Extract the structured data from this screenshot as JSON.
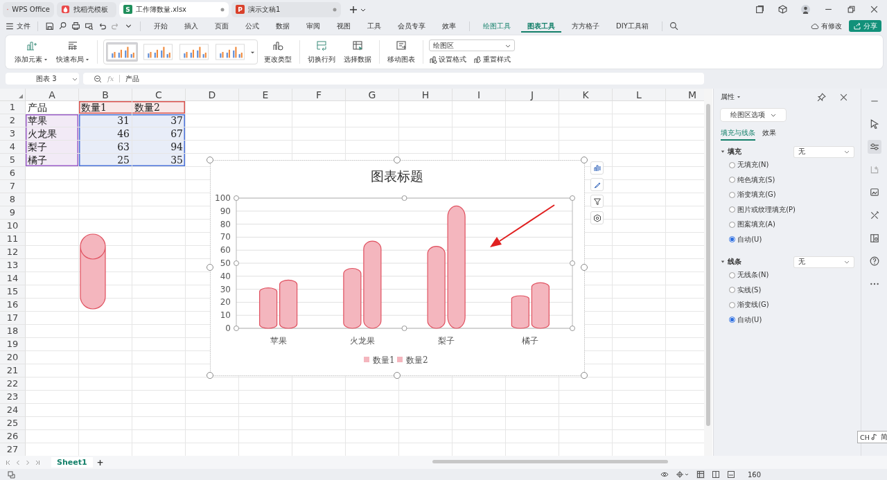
{
  "tabs": [
    {
      "label": "WPS Office",
      "selected": false,
      "kind": "home"
    },
    {
      "label": "找稻壳模板",
      "selected": false,
      "kind": "template"
    },
    {
      "label": "工作簿数量.xlsx",
      "selected": true,
      "kind": "sheet",
      "badge": "S"
    },
    {
      "label": "演示文稿1",
      "selected": false,
      "kind": "slides",
      "badge": "P"
    }
  ],
  "menu": {
    "file": "文件",
    "items": [
      {
        "label": "开始",
        "selected": false,
        "context": false
      },
      {
        "label": "插入",
        "selected": false,
        "context": false
      },
      {
        "label": "页面",
        "selected": false,
        "context": false
      },
      {
        "label": "公式",
        "selected": false,
        "context": false
      },
      {
        "label": "数据",
        "selected": false,
        "context": false
      },
      {
        "label": "审阅",
        "selected": false,
        "context": false
      },
      {
        "label": "视图",
        "selected": false,
        "context": false
      },
      {
        "label": "工具",
        "selected": false,
        "context": false
      },
      {
        "label": "会员专享",
        "selected": false,
        "context": false
      },
      {
        "label": "效率",
        "selected": false,
        "context": false
      },
      {
        "label": "绘图工具",
        "selected": false,
        "context": true
      },
      {
        "label": "图表工具",
        "selected": true,
        "context": true
      },
      {
        "label": "方方格子",
        "selected": false,
        "context": false
      },
      {
        "label": "DIY工具箱",
        "selected": false,
        "context": false
      }
    ],
    "sync": "有修改",
    "share": "分享"
  },
  "ribbon": {
    "add_element": "添加元素",
    "quick_layout": "快速布局",
    "styles": [
      {
        "selected": true
      },
      {
        "selected": false
      },
      {
        "selected": false
      },
      {
        "selected": false
      }
    ],
    "change_type": "更改类型",
    "switch_rows": "切换行列",
    "select_data": "选择数据",
    "move_chart": "移动图表",
    "element_select": "绘图区",
    "format": "设置格式",
    "reset_style": "重置样式"
  },
  "formula_bar": {
    "name_box": "图表 3",
    "fx": "fx",
    "value": "产品"
  },
  "sheet": {
    "columns": [
      "A",
      "B",
      "C",
      "D",
      "E",
      "F",
      "G",
      "H",
      "I",
      "J",
      "K",
      "L",
      "M"
    ],
    "rows": [
      {
        "label": "1",
        "cells": [
          {
            "text": "产品",
            "kind": "plain"
          },
          {
            "text": "数量1",
            "kind": "series"
          },
          {
            "text": "数量2",
            "kind": "series"
          }
        ]
      },
      {
        "label": "2",
        "cells": [
          {
            "text": "苹果",
            "kind": "category"
          },
          {
            "text": "31",
            "kind": "value"
          },
          {
            "text": "37",
            "kind": "value"
          }
        ]
      },
      {
        "label": "3",
        "cells": [
          {
            "text": "火龙果",
            "kind": "category"
          },
          {
            "text": "46",
            "kind": "value"
          },
          {
            "text": "67",
            "kind": "value"
          }
        ]
      },
      {
        "label": "4",
        "cells": [
          {
            "text": "梨子",
            "kind": "category"
          },
          {
            "text": "63",
            "kind": "value"
          },
          {
            "text": "94",
            "kind": "value"
          }
        ]
      },
      {
        "label": "5",
        "cells": [
          {
            "text": "橘子",
            "kind": "category"
          },
          {
            "text": "25",
            "kind": "value"
          },
          {
            "text": "35",
            "kind": "value"
          }
        ]
      },
      {
        "label": "6"
      },
      {
        "label": "7"
      },
      {
        "label": "8"
      },
      {
        "label": "9"
      },
      {
        "label": "10"
      },
      {
        "label": "11"
      },
      {
        "label": "12"
      },
      {
        "label": "13"
      },
      {
        "label": "14"
      },
      {
        "label": "15"
      },
      {
        "label": "16"
      },
      {
        "label": "17"
      },
      {
        "label": "18"
      },
      {
        "label": "19"
      },
      {
        "label": "20"
      },
      {
        "label": "21"
      },
      {
        "label": "22"
      },
      {
        "label": "23"
      },
      {
        "label": "24"
      },
      {
        "label": "25"
      },
      {
        "label": "26"
      },
      {
        "label": "27"
      }
    ]
  },
  "chart": {
    "chart_data": {
      "type": "bar",
      "title": "图表标题",
      "categories": [
        "苹果",
        "火龙果",
        "梨子",
        "橘子"
      ],
      "series": [
        {
          "name": "数量1",
          "color": "#f4b6be",
          "values": [
            31,
            46,
            63,
            25
          ]
        },
        {
          "name": "数量2",
          "color": "#f4b6be",
          "values": [
            37,
            67,
            94,
            35
          ]
        }
      ],
      "ylim": [
        0,
        100
      ],
      "yticks": [
        0,
        10,
        20,
        30,
        40,
        50,
        60,
        70,
        80,
        90,
        100
      ],
      "grid": true,
      "legend": true
    }
  },
  "panel": {
    "title": "属性",
    "selector": "绘图区选项",
    "tabs": [
      {
        "label": "填充与线条",
        "selected": true
      },
      {
        "label": "效果",
        "selected": false
      }
    ],
    "sections": [
      {
        "title": "填充",
        "expanded": true,
        "value": "无",
        "options": [
          {
            "label": "无填充(N)",
            "selected": false
          },
          {
            "label": "纯色填充(S)",
            "selected": false
          },
          {
            "label": "渐变填充(G)",
            "selected": false
          },
          {
            "label": "图片或纹理填充(P)",
            "selected": false
          },
          {
            "label": "图案填充(A)",
            "selected": false
          },
          {
            "label": "自动(U)",
            "selected": true
          }
        ]
      },
      {
        "title": "线条",
        "expanded": true,
        "value": "无",
        "options": [
          {
            "label": "无线条(N)",
            "selected": false
          },
          {
            "label": "实线(S)",
            "selected": false
          },
          {
            "label": "渐变线(G)",
            "selected": false
          },
          {
            "label": "自动(U)",
            "selected": true
          }
        ]
      }
    ]
  },
  "sheet_tabs": [
    {
      "label": "Sheet1",
      "selected": true
    }
  ],
  "add_sheet": "+",
  "status": {
    "zoom": "160"
  },
  "ime": {
    "lang": "CH",
    "mode": "简"
  }
}
